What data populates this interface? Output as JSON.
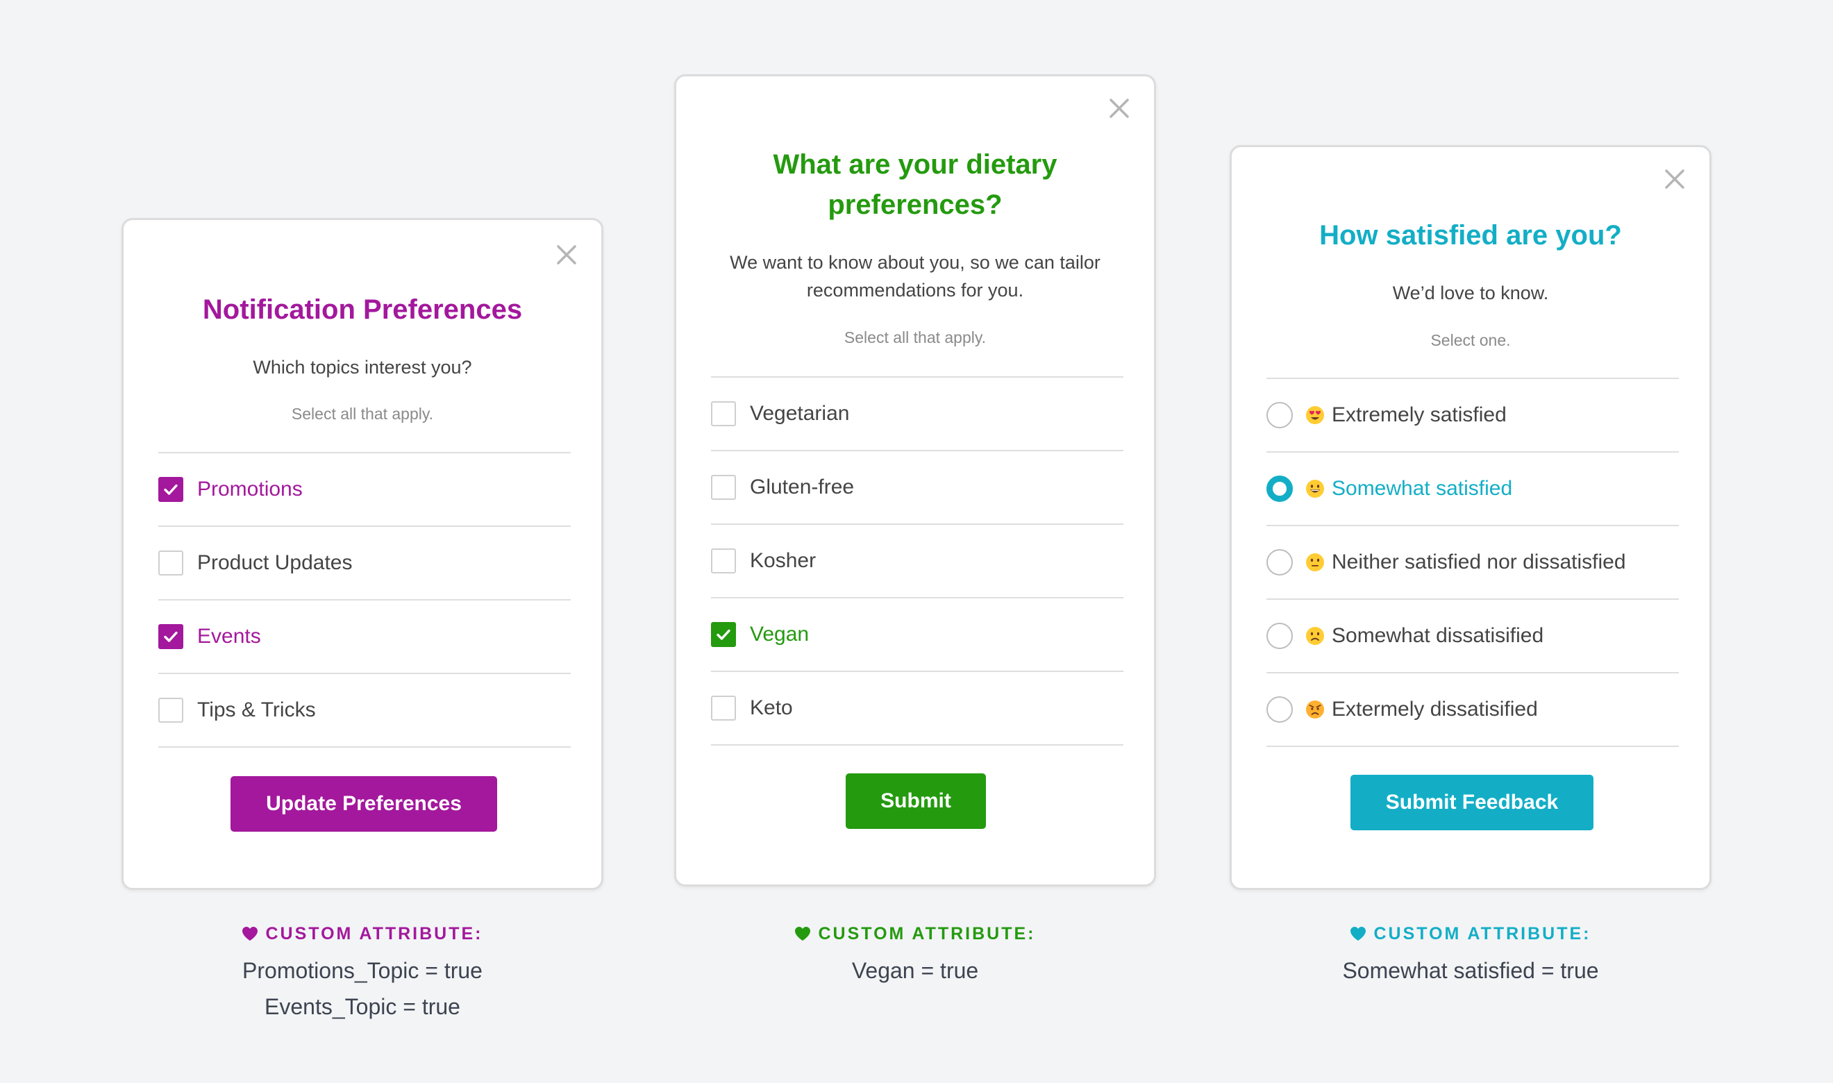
{
  "colors": {
    "background": "#f3f4f6",
    "purple": "#a3189c",
    "green": "#249a0f",
    "teal": "#13aec6",
    "divider": "#dedede",
    "text": "#444444",
    "muted": "#8a8a8a"
  },
  "cards": [
    {
      "close_icon": "close-icon",
      "title": "Notification Preferences",
      "subtitle": "Which topics interest you?",
      "hint": "Select all that apply.",
      "options": [
        {
          "label": "Promotions",
          "checked": true
        },
        {
          "label": "Product Updates",
          "checked": false
        },
        {
          "label": "Events",
          "checked": true
        },
        {
          "label": "Tips & Tricks",
          "checked": false
        }
      ],
      "button_label": "Update Preferences",
      "caption": {
        "icon": "heart-icon",
        "heading": "CUSTOM ATTRIBUTE:",
        "lines": [
          "Promotions_Topic = true",
          "Events_Topic = true"
        ]
      }
    },
    {
      "close_icon": "close-icon",
      "title_line1": "What are your dietary",
      "title_line2": "preferences?",
      "subtitle_line1": "We want to know about you, so we can tailor",
      "subtitle_line2": "recommendations for you.",
      "hint": "Select all that apply.",
      "options": [
        {
          "label": "Vegetarian",
          "checked": false
        },
        {
          "label": "Gluten-free",
          "checked": false
        },
        {
          "label": "Kosher",
          "checked": false
        },
        {
          "label": "Vegan",
          "checked": true
        },
        {
          "label": "Keto",
          "checked": false
        }
      ],
      "button_label": "Submit",
      "caption": {
        "icon": "heart-icon",
        "heading": "CUSTOM ATTRIBUTE:",
        "lines": [
          "Vegan = true"
        ]
      }
    },
    {
      "close_icon": "close-icon",
      "title": "How satisfied are you?",
      "subtitle": "We’d love to know.",
      "hint": "Select one.",
      "options": [
        {
          "label": "Extremely satisfied",
          "emoji": "heart-eyes-emoji",
          "selected": false
        },
        {
          "label": "Somewhat satisfied",
          "emoji": "grinning-emoji",
          "selected": true
        },
        {
          "label": "Neither satisfied nor dissatisfied",
          "emoji": "neutral-face-emoji",
          "selected": false
        },
        {
          "label": "Somewhat dissatisified",
          "emoji": "slightly-frowning-emoji",
          "selected": false
        },
        {
          "label": "Extermely dissatisified",
          "emoji": "angry-face-emoji",
          "selected": false
        }
      ],
      "button_label": "Submit Feedback",
      "caption": {
        "icon": "heart-icon",
        "heading": "CUSTOM ATTRIBUTE:",
        "lines": [
          "Somewhat satisfied = true"
        ]
      }
    }
  ]
}
